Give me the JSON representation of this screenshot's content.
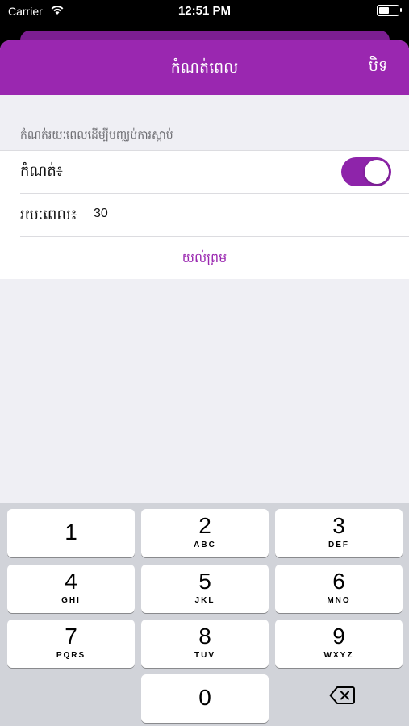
{
  "status_bar": {
    "carrier": "Carrier",
    "time": "12:51 PM",
    "battery_level": 0.6
  },
  "navbar": {
    "title": "កំណត់ពេល",
    "close_label": "បិទ"
  },
  "section": {
    "header": "កំណត់រយៈពេលដើម្បីបញ្ឈប់ការស្តាប់"
  },
  "settings": {
    "enable_label": "កំណត់៖",
    "enabled": true,
    "duration_label": "រយៈពេល៖",
    "duration_value": "30",
    "agree_label": "យល់ព្រម"
  },
  "keypad": {
    "keys": [
      {
        "num": "1",
        "letters": ""
      },
      {
        "num": "2",
        "letters": "ABC"
      },
      {
        "num": "3",
        "letters": "DEF"
      },
      {
        "num": "4",
        "letters": "GHI"
      },
      {
        "num": "5",
        "letters": "JKL"
      },
      {
        "num": "6",
        "letters": "MNO"
      },
      {
        "num": "7",
        "letters": "PQRS"
      },
      {
        "num": "8",
        "letters": "TUV"
      },
      {
        "num": "9",
        "letters": "WXYZ"
      },
      {
        "num": "0",
        "letters": ""
      }
    ],
    "backspace_icon": "backspace-icon"
  },
  "colors": {
    "accent": "#9a27b0",
    "toggle_on": "#8e24aa",
    "background": "#efeff4",
    "keyboard": "#d1d3d9"
  }
}
